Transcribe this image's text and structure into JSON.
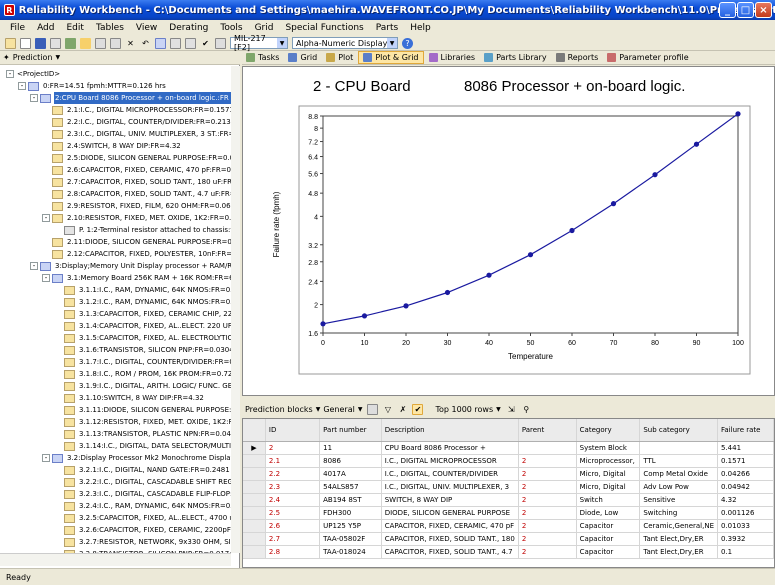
{
  "window": {
    "title": "Reliability Workbench - C:\\Documents and Settings\\maehira.WAVEFRONT.CO.JP\\My Documents\\Reliability Workbench\\11.0\\Projects\\TutorialComplete.rwb",
    "min_label": "_",
    "max_label": "□",
    "close_label": "×"
  },
  "menu": [
    "File",
    "Add",
    "Edit",
    "Tables",
    "View",
    "Derating",
    "Tools",
    "Grid",
    "Special Functions",
    "Parts",
    "Help"
  ],
  "toolbar": {
    "standard_combo": "MIL-217 [F2]",
    "display_combo": "Alpha-Numeric Display"
  },
  "left_panel": {
    "header": "Prediction"
  },
  "tree": [
    {
      "level": 0,
      "pm": "-",
      "icon": "none",
      "text": "<ProjectID>"
    },
    {
      "level": 1,
      "pm": "-",
      "icon": "blue",
      "text": "0:FR=14.51 fpmh:MTTR=0.126 hrs"
    },
    {
      "level": 2,
      "pm": "-",
      "icon": "blue",
      "text": "2:CPU Board        8086 Processor + on-board logic.:FR",
      "selected": true
    },
    {
      "level": 3,
      "pm": "",
      "icon": "folder",
      "text": "2.1:I.C., DIGITAL MICROPROCESSOR:FR=0.1571"
    },
    {
      "level": 3,
      "pm": "",
      "icon": "folder",
      "text": "2.2:I.C., DIGITAL, COUNTER/DIVIDER:FR=0.2133"
    },
    {
      "level": 3,
      "pm": "",
      "icon": "folder",
      "text": "2.3:I.C., DIGITAL, UNIV. MULTIPLEXER, 3 ST.:FR=0.0"
    },
    {
      "level": 3,
      "pm": "",
      "icon": "folder",
      "text": "2.4:SWITCH, 8 WAY DIP:FR=4.32"
    },
    {
      "level": 3,
      "pm": "",
      "icon": "folder",
      "text": "2.5:DIODE, SILICON GENERAL PURPOSE:FR=0.00112"
    },
    {
      "level": 3,
      "pm": "",
      "icon": "folder",
      "text": "2.6:CAPACITOR, FIXED, CERAMIC, 470 pF:FR=0.0103"
    },
    {
      "level": 3,
      "pm": "",
      "icon": "folder",
      "text": "2.7:CAPACITOR, FIXED, SOLID TANT., 180 uF:FR=0.3"
    },
    {
      "level": 3,
      "pm": "",
      "icon": "folder",
      "text": "2.8:CAPACITOR, FIXED, SOLID TANT., 4.7 uF:FR=0.1"
    },
    {
      "level": 3,
      "pm": "",
      "icon": "folder",
      "text": "2.9:RESISTOR, FIXED, FILM, 620 OHM:FR=0.06154"
    },
    {
      "level": 3,
      "pm": "-",
      "icon": "folder",
      "text": "2.10:RESISTOR, FIXED, MET. OXIDE, 1K2:FR=0.01327"
    },
    {
      "level": 4,
      "pm": "",
      "icon": "note",
      "text": "P. 1:2-Terminal resistor attached to chassis:t=0.1"
    },
    {
      "level": 3,
      "pm": "",
      "icon": "folder",
      "text": "2.11:DIODE, SILICON GENERAL PURPOSE:FR=0.0013"
    },
    {
      "level": 3,
      "pm": "",
      "icon": "folder",
      "text": "2.12:CAPACITOR, FIXED, POLYESTER, 10nF:FR=0.00"
    },
    {
      "level": 2,
      "pm": "-",
      "icon": "blue",
      "text": "3:Display;Memory Unit Display processor + RAM/ROM Bo"
    },
    {
      "level": 3,
      "pm": "-",
      "icon": "blue",
      "text": "3.1:Memory Board        256K RAM + 16K ROM:FR=6."
    },
    {
      "level": 4,
      "pm": "",
      "icon": "folder",
      "text": "3.1.1:I.C., RAM, DYNAMIC, 64K NMOS:FR=0.5723"
    },
    {
      "level": 4,
      "pm": "",
      "icon": "folder",
      "text": "3.1.2:I.C., RAM, DYNAMIC, 64K NMOS:FR=0.5723"
    },
    {
      "level": 4,
      "pm": "",
      "icon": "folder",
      "text": "3.1.3:CAPACITOR, FIXED, CERAMIC CHIP, 220 pF"
    },
    {
      "level": 4,
      "pm": "",
      "icon": "folder",
      "text": "3.1.4:CAPACITOR, FIXED, AL..ELECT. 220 UF:FR"
    },
    {
      "level": 4,
      "pm": "",
      "icon": "folder",
      "text": "3.1.5:CAPACITOR, FIXED, AL. ELECTROLYTIC:FR"
    },
    {
      "level": 4,
      "pm": "",
      "icon": "folder",
      "text": "3.1.6:TRANSISTOR, SILICON PNP:FR=0.03049"
    },
    {
      "level": 4,
      "pm": "",
      "icon": "folder",
      "text": "3.1.7:I.C., DIGITAL, COUNTER/DIVIDER:FR=0.170"
    },
    {
      "level": 4,
      "pm": "",
      "icon": "folder",
      "text": "3.1.8:I.C., ROM / PROM, 16K PROM:FR=0.7247"
    },
    {
      "level": 4,
      "pm": "",
      "icon": "folder",
      "text": "3.1.9:I.C., DIGITAL, ARITH. LOGIC/ FUNC. GEN.:F"
    },
    {
      "level": 4,
      "pm": "",
      "icon": "folder",
      "text": "3.1.10:SWITCH, 8 WAY DIP:FR=4.32"
    },
    {
      "level": 4,
      "pm": "",
      "icon": "folder",
      "text": "3.1.11:DIODE, SILICON GENERAL PURPOSE:FR=0.0"
    },
    {
      "level": 4,
      "pm": "",
      "icon": "folder",
      "text": "3.1.12:RESISTOR, FIXED, MET. OXIDE, 1K2:FR=0.0"
    },
    {
      "level": 4,
      "pm": "",
      "icon": "folder",
      "text": "3.1.13:TRANSISTOR, PLASTIC NPN:FR=0.04084"
    },
    {
      "level": 4,
      "pm": "",
      "icon": "folder",
      "text": "3.1.14:I.C., DIGITAL, DATA SELECTOR/MULTIPLE"
    },
    {
      "level": 3,
      "pm": "-",
      "icon": "blue",
      "text": "3.2:Display Processor   Mk2 Monochrome Display bo"
    },
    {
      "level": 4,
      "pm": "",
      "icon": "folder",
      "text": "3.2.1:I.C., DIGITAL, NAND GATE:FR=0.2481"
    },
    {
      "level": 4,
      "pm": "",
      "icon": "folder",
      "text": "3.2.2:I.C., DIGITAL, CASCADABLE SHIFT REGIST"
    },
    {
      "level": 4,
      "pm": "",
      "icon": "folder",
      "text": "3.2.3:I.C., DIGITAL, CASCADABLE FLIP-FLOP:FR="
    },
    {
      "level": 4,
      "pm": "",
      "icon": "folder",
      "text": "3.2.4:I.C., RAM, DYNAMIC, 64K NMOS:FR=0.782"
    },
    {
      "level": 4,
      "pm": "",
      "icon": "folder",
      "text": "3.2.5:CAPACITOR, FIXED, AL..ELECT., 4700 uF:F"
    },
    {
      "level": 4,
      "pm": "",
      "icon": "folder",
      "text": "3.2.6:CAPACITOR, FIXED, CERAMIC, 2200pF:FR="
    },
    {
      "level": 4,
      "pm": "",
      "icon": "folder",
      "text": "3.2.7:RESISTOR, NETWORK, 9x330 OHM, SIL:FR"
    },
    {
      "level": 4,
      "pm": "",
      "icon": "folder",
      "text": "3.2.8:TRANSISTOR, SILICON PNP:FR=0.01742"
    },
    {
      "level": 4,
      "pm": "",
      "icon": "folder",
      "text": "3.2.9:RESISTOR, FIXED, MET. OXIDE, 1K2:FR=0.0"
    }
  ],
  "tabs": [
    {
      "label": "Tasks",
      "color": "#7fa66b",
      "active": false
    },
    {
      "label": "Grid",
      "color": "#5a7ec8",
      "active": false
    },
    {
      "label": "Plot",
      "color": "#c8a84a",
      "active": false
    },
    {
      "label": "Plot & Grid",
      "color": "#5a7ec8",
      "active": true
    },
    {
      "label": "Libraries",
      "color": "#a46bc8",
      "active": false
    },
    {
      "label": "Parts Library",
      "color": "#5aa0c8",
      "active": false
    },
    {
      "label": "Reports",
      "color": "#7a7a7a",
      "active": false
    },
    {
      "label": "Parameter profile",
      "color": "#c86b6b",
      "active": false
    }
  ],
  "chart_data": {
    "type": "line",
    "title_left": "2 - CPU Board",
    "title_right": "8086 Processor + on-board logic.",
    "xlabel": "Temperature",
    "ylabel": "Failure rate (fpmh)",
    "xlim": [
      0,
      100
    ],
    "ylim": [
      1.6,
      8.8
    ],
    "y_scale": "log",
    "x_ticks": [
      "0",
      "10",
      "20",
      "30",
      "40",
      "50",
      "60",
      "70",
      "80",
      "90",
      "100"
    ],
    "y_ticks": [
      "1.6",
      "2",
      "2.4",
      "2.8",
      "3.2",
      "4",
      "4.8",
      "5.6",
      "6.4",
      "7.2",
      "8",
      "8.8"
    ],
    "series": [
      {
        "color": "#1a1aa0",
        "x": [
          0,
          10,
          20,
          30,
          40,
          50,
          60,
          70,
          80,
          90,
          100
        ],
        "y": [
          1.72,
          1.83,
          1.98,
          2.2,
          2.52,
          2.96,
          3.58,
          4.42,
          5.55,
          7.05,
          8.95
        ]
      }
    ]
  },
  "grid_toolbar": {
    "prediction_blocks": "Prediction blocks",
    "general": "General",
    "top_rows": "Top 1000 rows"
  },
  "grid": {
    "columns": [
      "ID",
      "Part number",
      "Description",
      "Parent",
      "Category",
      "Sub category",
      "Failure rate"
    ],
    "rows": [
      {
        "marker": "▶",
        "id": "2",
        "part": "11",
        "desc": "CPU Board        8086 Processor +",
        "parent": "",
        "cat": "System Block",
        "sub": "",
        "fr": "5.441"
      },
      {
        "marker": "",
        "id": "2.1",
        "part": "8086",
        "desc": "I.C., DIGITAL MICROPROCESSOR",
        "parent": "2",
        "cat": "Microprocessor,",
        "sub": "TTL",
        "fr": "0.1571"
      },
      {
        "marker": "",
        "id": "2.2",
        "part": "4017A",
        "desc": "I.C., DIGITAL, COUNTER/DIVIDER",
        "parent": "2",
        "cat": "Micro, Digital",
        "sub": "Comp Metal Oxide",
        "fr": "0.04266"
      },
      {
        "marker": "",
        "id": "2.3",
        "part": "54ALS857",
        "desc": "I.C., DIGITAL, UNIV. MULTIPLEXER, 3",
        "parent": "2",
        "cat": "Micro, Digital",
        "sub": "Adv Low Pow",
        "fr": "0.04942"
      },
      {
        "marker": "",
        "id": "2.4",
        "part": "AB194 8ST",
        "desc": "SWITCH, 8 WAY DIP",
        "parent": "2",
        "cat": "Switch",
        "sub": "Sensitive",
        "fr": "4.32"
      },
      {
        "marker": "",
        "id": "2.5",
        "part": "FDH300",
        "desc": "DIODE, SILICON GENERAL PURPOSE",
        "parent": "2",
        "cat": "Diode, Low",
        "sub": "Switching",
        "fr": "0.001126"
      },
      {
        "marker": "",
        "id": "2.6",
        "part": "UP125 Y5P",
        "desc": "CAPACITOR, FIXED, CERAMIC, 470 pF",
        "parent": "2",
        "cat": "Capacitor",
        "sub": "Ceramic,General,NE",
        "fr": "0.01033"
      },
      {
        "marker": "",
        "id": "2.7",
        "part": "TAA-05802F",
        "desc": "CAPACITOR, FIXED, SOLID TANT., 180",
        "parent": "2",
        "cat": "Capacitor",
        "sub": "Tant Elect,Dry,ER",
        "fr": "0.3932"
      },
      {
        "marker": "",
        "id": "2.8",
        "part": "TAA-018024",
        "desc": "CAPACITOR, FIXED, SOLID TANT., 4.7",
        "parent": "2",
        "cat": "Capacitor",
        "sub": "Tant Elect,Dry,ER",
        "fr": "0.1"
      }
    ]
  },
  "status": {
    "text": "Ready"
  }
}
